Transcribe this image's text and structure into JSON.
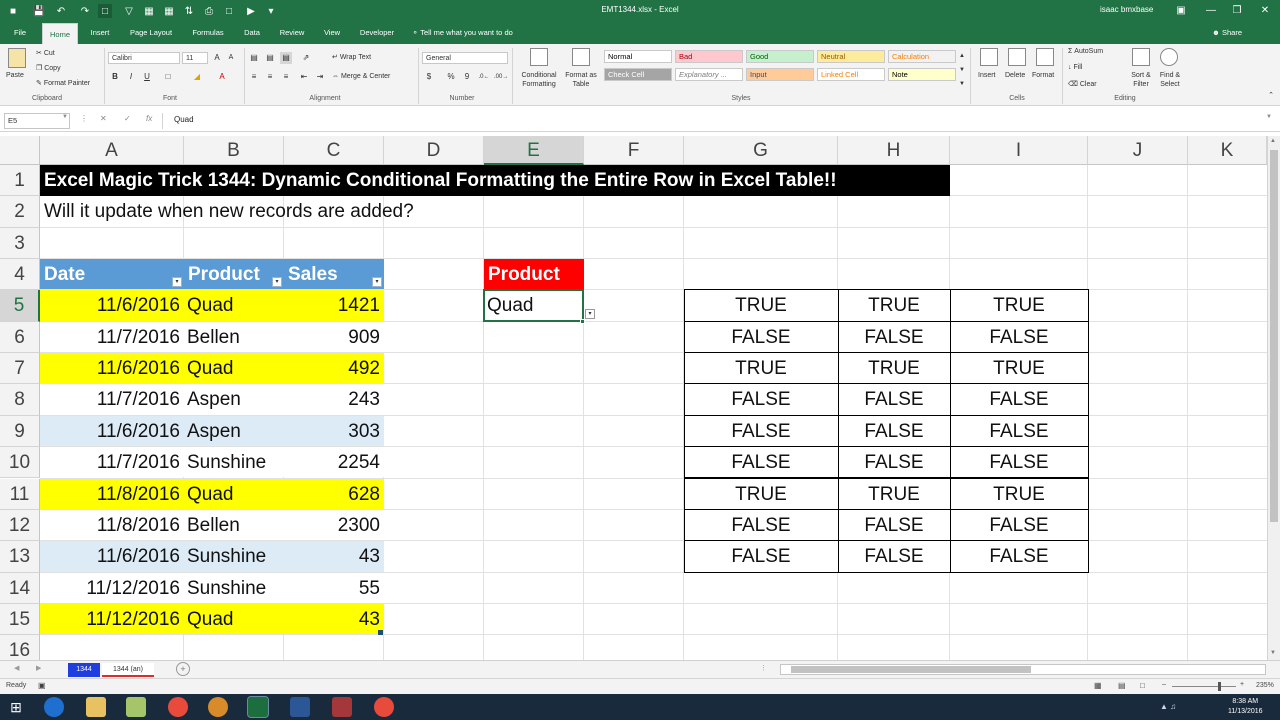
{
  "window": {
    "title": "EMT1344.xlsx - Excel",
    "user": "isaac bmxbase",
    "min": "—",
    "restore": "❒",
    "close": "✕"
  },
  "ribbon_tabs": [
    "File",
    "Home",
    "Insert",
    "Page Layout",
    "Formulas",
    "Data",
    "Review",
    "View",
    "Developer"
  ],
  "tell_me": "Tell me what you want to do",
  "share": "Share",
  "ribbon": {
    "paste": "Paste",
    "cut": "Cut",
    "copy": "Copy",
    "format_painter": "Format Painter",
    "clipboard": "Clipboard",
    "font_name": "Calibri",
    "font_size": "11",
    "bold": "B",
    "italic": "I",
    "underline": "U",
    "font": "Font",
    "wrap_text": "Wrap Text",
    "merge_center": "Merge & Center",
    "alignment": "Alignment",
    "number_format": "General",
    "currency": "$",
    "percent": "%",
    "comma": "9",
    "number": "Number",
    "conditional_formatting": [
      "Conditional",
      "Formatting"
    ],
    "format_as_table": [
      "Format as",
      "Table"
    ],
    "styles_label": "Styles",
    "styles": [
      {
        "name": "Normal",
        "bg": "#ffffff",
        "color": "#000000"
      },
      {
        "name": "Bad",
        "bg": "#ffc7ce",
        "color": "#9c0006"
      },
      {
        "name": "Good",
        "bg": "#c6efce",
        "color": "#006100"
      },
      {
        "name": "Neutral",
        "bg": "#ffeb9c",
        "color": "#9c5700"
      },
      {
        "name": "Calculation",
        "bg": "#f2f2f2",
        "color": "#fa7d00"
      },
      {
        "name": "Check Cell",
        "bg": "#a5a5a5",
        "color": "#ffffff"
      },
      {
        "name": "Explanatory ...",
        "bg": "#ffffff",
        "color": "#7f7f7f"
      },
      {
        "name": "Input",
        "bg": "#ffcc99",
        "color": "#3f3f76"
      },
      {
        "name": "Linked Cell",
        "bg": "#ffffff",
        "color": "#fa7d00"
      },
      {
        "name": "Note",
        "bg": "#ffffcc",
        "color": "#000000"
      }
    ],
    "insert": "Insert",
    "delete": "Delete",
    "format": "Format",
    "cells": "Cells",
    "autosum": "AutoSum",
    "fill": "Fill",
    "clear": "Clear",
    "sort_filter": [
      "Sort &",
      "Filter"
    ],
    "find_select": [
      "Find &",
      "Select"
    ],
    "editing": "Editing"
  },
  "formula_bar": {
    "name_box": "E5",
    "formula": "Quad",
    "cancel": "✕",
    "enter": "✓",
    "fx": "fx"
  },
  "columns": [
    "A",
    "B",
    "C",
    "D",
    "E",
    "F",
    "G",
    "H",
    "I",
    "J",
    "K"
  ],
  "rows": [
    "1",
    "2",
    "3",
    "4",
    "5",
    "6",
    "7",
    "8",
    "9",
    "10",
    "11",
    "12",
    "13",
    "14",
    "15",
    "16"
  ],
  "cells": {
    "title": "Excel Magic Trick 1344: Dynamic Conditional Formatting the Entire Row in Excel Table!!",
    "question": "Will it update when new records are added?",
    "table_headers": [
      "Date",
      "Product",
      "Sales"
    ],
    "table_rows": [
      {
        "date": "11/6/2016",
        "product": "Quad",
        "sales": "1421"
      },
      {
        "date": "11/7/2016",
        "product": "Bellen",
        "sales": "909"
      },
      {
        "date": "11/6/2016",
        "product": "Quad",
        "sales": "492"
      },
      {
        "date": "11/7/2016",
        "product": "Aspen",
        "sales": "243"
      },
      {
        "date": "11/6/2016",
        "product": "Aspen",
        "sales": "303"
      },
      {
        "date": "11/7/2016",
        "product": "Sunshine",
        "sales": "2254"
      },
      {
        "date": "11/8/2016",
        "product": "Quad",
        "sales": "628"
      },
      {
        "date": "11/8/2016",
        "product": "Bellen",
        "sales": "2300"
      },
      {
        "date": "11/6/2016",
        "product": "Sunshine",
        "sales": "43"
      },
      {
        "date": "11/12/2016",
        "product": "Sunshine",
        "sales": "55"
      },
      {
        "date": "11/12/2016",
        "product": "Quad",
        "sales": "43"
      }
    ],
    "criteria_label": "Product",
    "criteria_value": "Quad",
    "bool_rows": [
      [
        "TRUE",
        "TRUE",
        "TRUE"
      ],
      [
        "FALSE",
        "FALSE",
        "FALSE"
      ],
      [
        "TRUE",
        "TRUE",
        "TRUE"
      ],
      [
        "FALSE",
        "FALSE",
        "FALSE"
      ],
      [
        "FALSE",
        "FALSE",
        "FALSE"
      ],
      [
        "FALSE",
        "FALSE",
        "FALSE"
      ],
      [
        "TRUE",
        "TRUE",
        "TRUE"
      ],
      [
        "FALSE",
        "FALSE",
        "FALSE"
      ],
      [
        "FALSE",
        "FALSE",
        "FALSE"
      ]
    ]
  },
  "colors": {
    "excel_green": "#217346",
    "highlight_yellow": "#ffff00",
    "band_blue": "#ddebf7",
    "header_blue": "#5b9bd5",
    "criteria_red": "#ff0000"
  },
  "sheet_tabs": [
    "1344",
    "1344 (an)"
  ],
  "status": {
    "ready": "Ready",
    "zoom": "235%"
  },
  "taskbar": {
    "time": "8:38 AM",
    "date": "11/13/2016"
  }
}
